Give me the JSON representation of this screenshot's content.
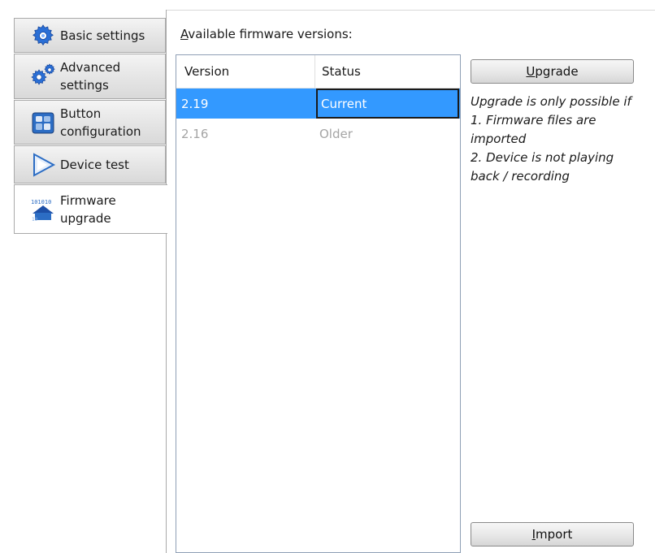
{
  "tabs": {
    "basic": "Basic settings",
    "advanced_l1": "Advanced",
    "advanced_l2": "settings",
    "button_l1": "Button",
    "button_l2": "configuration",
    "device_test": "Device test",
    "firmware_l1": "Firmware",
    "firmware_l2": "upgrade"
  },
  "firmware": {
    "label_accel": "A",
    "label_rest": "vailable firmware versions:",
    "columns": {
      "version": "Version",
      "status": "Status"
    },
    "rows": [
      {
        "version": "2.19",
        "status": "Current"
      },
      {
        "version": "2.16",
        "status": "Older"
      }
    ]
  },
  "buttons": {
    "upgrade_accel": "U",
    "upgrade_rest": "pgrade",
    "import_accel": "I",
    "import_rest": "mport"
  },
  "note": {
    "line1": "Upgrade is only possible if",
    "line2": "1. Firmware files are",
    "line3": "imported",
    "line4": "2. Device is not playing",
    "line5": "back / recording"
  },
  "colors": {
    "selection": "#3399ff",
    "list_border": "#8e9fb5",
    "older_text": "#a5a5a5"
  },
  "icons": {
    "basic": "gear-icon",
    "advanced": "gears-icon",
    "button": "button-config-icon",
    "device_test": "play-triangle-icon",
    "firmware": "firmware-chip-icon"
  }
}
